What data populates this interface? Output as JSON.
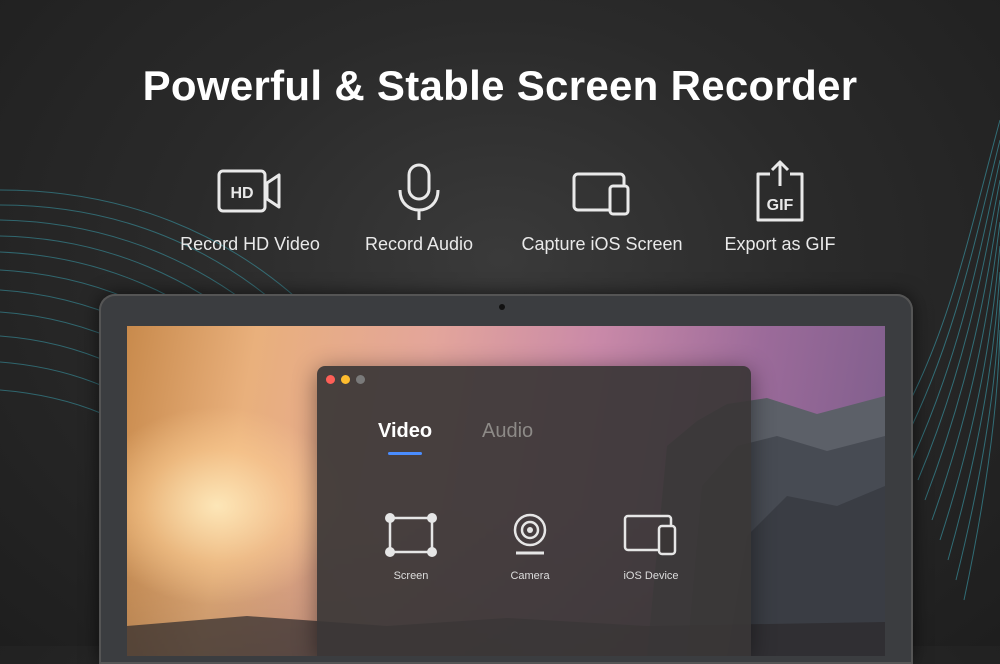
{
  "headline": "Powerful & Stable Screen Recorder",
  "features": [
    {
      "icon": "hd-video-icon",
      "label": "Record HD Video",
      "badge": "HD"
    },
    {
      "icon": "microphone-icon",
      "label": "Record Audio"
    },
    {
      "icon": "ios-screen-icon",
      "label": "Capture iOS Screen"
    },
    {
      "icon": "gif-export-icon",
      "label": "Export as GIF",
      "badge": "GIF"
    }
  ],
  "app": {
    "tabs": [
      {
        "label": "Video",
        "active": true
      },
      {
        "label": "Audio",
        "active": false
      }
    ],
    "options": [
      {
        "icon": "screen-select-icon",
        "label": "Screen"
      },
      {
        "icon": "camera-icon",
        "label": "Camera"
      },
      {
        "icon": "ios-device-icon",
        "label": "iOS Device"
      }
    ]
  },
  "colors": {
    "accent": "#4a8dff",
    "traffic_close": "#fe5f57",
    "traffic_minimize": "#febc2e",
    "traffic_zoom": "#7a7a7a",
    "wave": "#3fb8c9"
  }
}
